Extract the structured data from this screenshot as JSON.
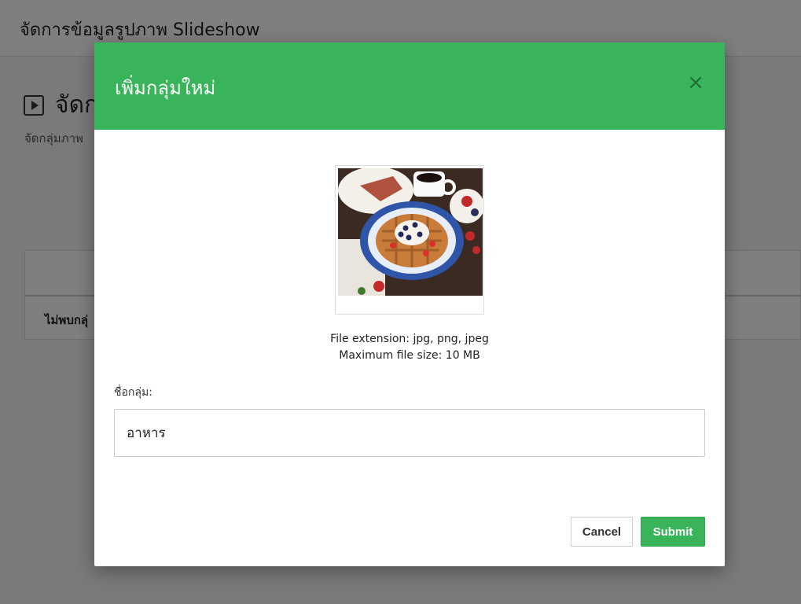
{
  "page": {
    "title": "จัดการข้อมูลรูปภาพ Slideshow",
    "heading": "จัดก",
    "subtitle": "จัดกลุ่มภาพ",
    "empty_message": "ไม่พบกลุ่"
  },
  "modal": {
    "title": "เพิ่มกลุ่มใหม่",
    "close_symbol": "×",
    "image_alt": "waffle-with-berries-and-cream",
    "file_extension": "File extension: jpg, png, jpeg",
    "max_size": "Maximum file size: 10 MB",
    "group_name_label": "ชื่อกลุ่ม:",
    "group_name_value": "อาหาร",
    "cancel_label": "Cancel",
    "submit_label": "Submit"
  },
  "colors": {
    "accent": "#3ab45a",
    "overlay": "rgba(0,0,0,0.5)"
  }
}
